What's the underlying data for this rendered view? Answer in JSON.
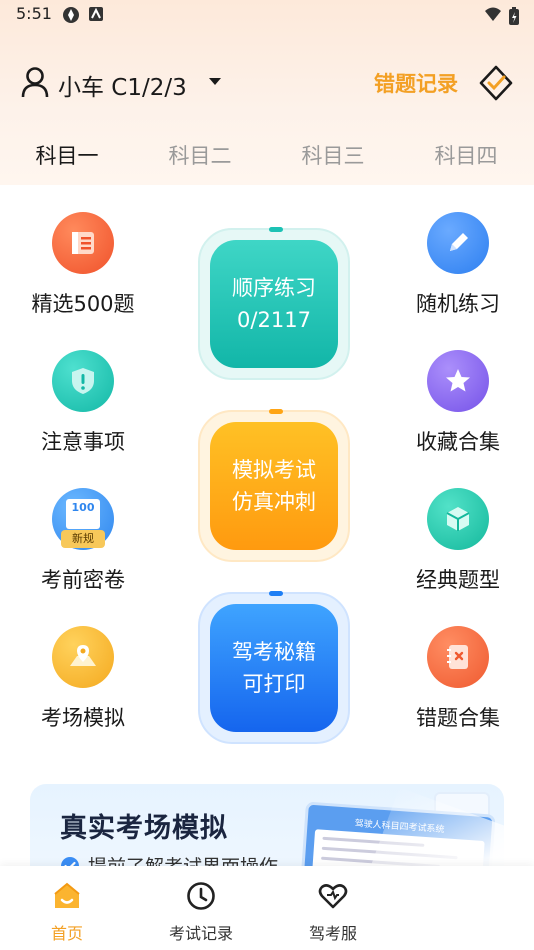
{
  "status_bar": {
    "time": "5:51"
  },
  "header": {
    "license_label": "小车 C1/2/3",
    "wrong_record_label": "错题记录"
  },
  "subject_tabs": [
    {
      "label": "科目一",
      "active": true
    },
    {
      "label": "科目二",
      "active": false
    },
    {
      "label": "科目三",
      "active": false
    },
    {
      "label": "科目四",
      "active": false
    }
  ],
  "left_items": [
    {
      "label": "精选500题",
      "icon": "list-book-icon",
      "color": "#f46a3c"
    },
    {
      "label": "注意事项",
      "icon": "shield-exclamation-icon",
      "color": "#1fc7b6"
    },
    {
      "label": "考前密卷",
      "icon": "exam-paper-icon",
      "color": "#3b9ff5",
      "badge": "新规",
      "badge_number": "100"
    },
    {
      "label": "考场模拟",
      "icon": "map-pin-icon",
      "color": "#f7b530"
    }
  ],
  "right_items": [
    {
      "label": "随机练习",
      "icon": "pencil-icon",
      "color": "#3f8ef5"
    },
    {
      "label": "收藏合集",
      "icon": "star-icon",
      "color": "#8d6cf0"
    },
    {
      "label": "经典题型",
      "icon": "cube-icon",
      "color": "#21c7ad"
    },
    {
      "label": "错题合集",
      "icon": "wrong-notebook-icon",
      "color": "#f46a3c"
    }
  ],
  "center_buttons": [
    {
      "line1": "顺序练习",
      "line2": "0/2117",
      "color": "#1cc2b4"
    },
    {
      "line1": "模拟考试",
      "line2": "仿真冲刺",
      "color": "#ffa515"
    },
    {
      "line1": "驾考秘籍",
      "line2": "可打印",
      "color": "#1e7ff5"
    }
  ],
  "banner": {
    "title": "真实考场模拟",
    "subtitle": "提前了解考试界面操作",
    "screen_title": "驾驶人科目四考试系统"
  },
  "bottom_nav": [
    {
      "label": "首页",
      "icon": "home-icon",
      "active": true
    },
    {
      "label": "考试记录",
      "icon": "clock-icon",
      "active": false
    },
    {
      "label": "驾考服",
      "icon": "heart-service-icon",
      "active": false
    }
  ],
  "colors": {
    "accent": "#f3a024",
    "text": "#1a1a1a",
    "muted": "#9a9a9a"
  }
}
